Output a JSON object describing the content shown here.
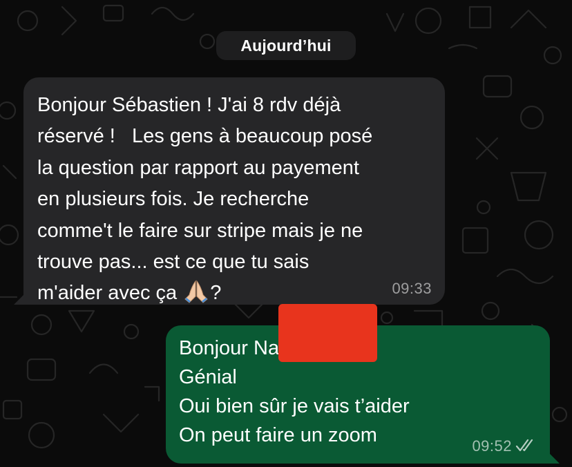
{
  "date_separator": "Aujourd’hui",
  "incoming": {
    "lines": [
      "Bonjour Sébastien ! J'ai 8 rdv déjà",
      "réservé !   Les gens à beaucoup posé",
      "la question par rapport au payement",
      "en plusieurs fois. Je recherche",
      "comme't le faire sur stripe mais je ne",
      "trouve pas... est ce que tu sais"
    ],
    "last_line_text": "m'aider avec ça ",
    "last_line_suffix": "?",
    "emoji": "folded-hands-icon",
    "time": "09:33",
    "bubble_color": "#262628"
  },
  "outgoing": {
    "lines": [
      "Bonjour Natashia",
      "Génial",
      "Oui bien sûr je vais t’aider",
      "On peut faire un zoom"
    ],
    "time": "09:52",
    "status": "double-check-read-icon",
    "bubble_color": "#0a5a34"
  },
  "redaction_color": "#e8341d",
  "background_color": "#0b0b0b"
}
